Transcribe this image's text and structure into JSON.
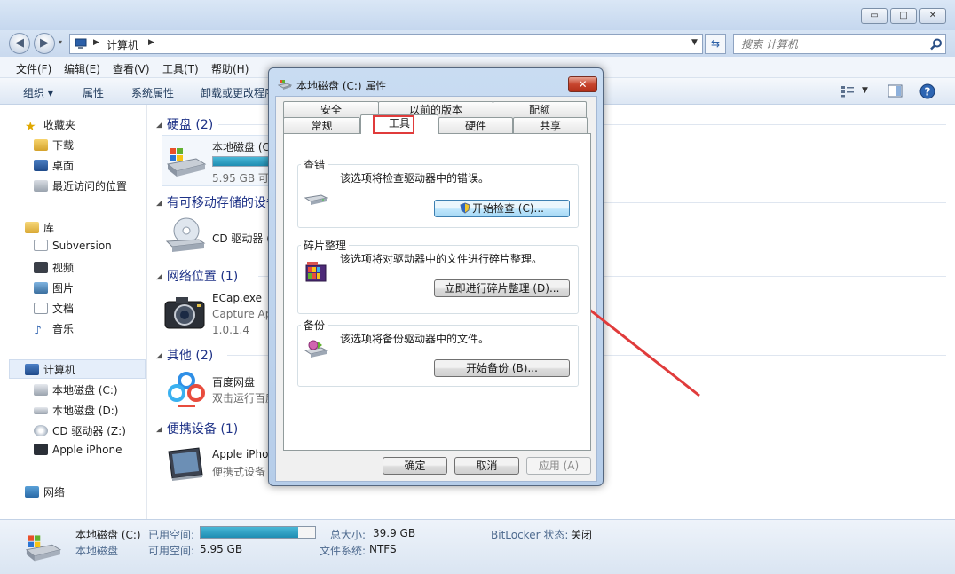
{
  "window": {
    "min_symbol": "▭",
    "max_symbol": "□",
    "close_symbol": "✕"
  },
  "address": {
    "path": "计算机",
    "search_placeholder": "搜索 计算机"
  },
  "menu": [
    "文件(F)",
    "编辑(E)",
    "查看(V)",
    "工具(T)",
    "帮助(H)"
  ],
  "toolbar": [
    "组织 ▾",
    "属性",
    "系统属性",
    "卸载或更改程序"
  ],
  "nav": {
    "favorites": "收藏夹",
    "downloads": "下载",
    "desktop": "桌面",
    "recent": "最近访问的位置",
    "libraries": "库",
    "subversion": "Subversion",
    "videos": "视频",
    "pictures": "图片",
    "documents": "文档",
    "music": "音乐",
    "computer": "计算机",
    "drive_c": "本地磁盘 (C:)",
    "drive_d": "本地磁盘 (D:)",
    "drive_z": "CD 驱动器 (Z:)",
    "iphone": "Apple iPhone",
    "network": "网络"
  },
  "content": {
    "hdd_group": "硬盘 (2)",
    "hdd_item_name": "本地磁盘 (C:)",
    "hdd_item_free": "5.95 GB 可用，共 39.9 GB",
    "hdd_fill_percent": 85,
    "removable_group": "有可移动存储的设备 (1)",
    "cd_item_name": "CD 驱动器 (Z:)",
    "network_group": "网络位置 (1)",
    "ecap_name": "ECap.exe",
    "ecap_desc": "Capture Application",
    "ecap_version": "1.0.1.4",
    "other_group": "其他 (2)",
    "baidu_name": "百度网盘",
    "baidu_desc": "双击运行百度网盘",
    "portable_group": "便携设备 (1)",
    "iphone_name": "Apple iPhone",
    "iphone_desc": "便携式设备"
  },
  "status": {
    "drive_name": "本地磁盘 (C:)",
    "drive_type": "本地磁盘",
    "used_label": "已用空间:",
    "free_label": "可用空间:",
    "free_value": "5.95 GB",
    "used_percent": 85,
    "total_label": "总大小:",
    "total_value": "39.9 GB",
    "fs_label": "文件系统:",
    "fs_value": "NTFS",
    "bitlocker_label": "BitLocker 状态:",
    "bitlocker_value": "关闭"
  },
  "dialog": {
    "title": "本地磁盘 (C:) 属性",
    "close": "✕",
    "tabs_row1": [
      "安全",
      "以前的版本",
      "配额"
    ],
    "tabs_row2": [
      "常规",
      "工具",
      "硬件",
      "共享"
    ],
    "active_tab": "工具",
    "check": {
      "title": "查错",
      "desc": "该选项将检查驱动器中的错误。",
      "button": "开始检查 (C)..."
    },
    "defrag": {
      "title": "碎片整理",
      "desc": "该选项将对驱动器中的文件进行碎片整理。",
      "button": "立即进行碎片整理 (D)..."
    },
    "backup": {
      "title": "备份",
      "desc": "该选项将备份驱动器中的文件。",
      "button": "开始备份 (B)..."
    },
    "ok": "确定",
    "cancel": "取消",
    "apply": "应用 (A)"
  },
  "colors": {
    "accent_bar": "#2a9fc2",
    "group_header": "#1e3287",
    "annotation_red": "#e03b3b"
  }
}
